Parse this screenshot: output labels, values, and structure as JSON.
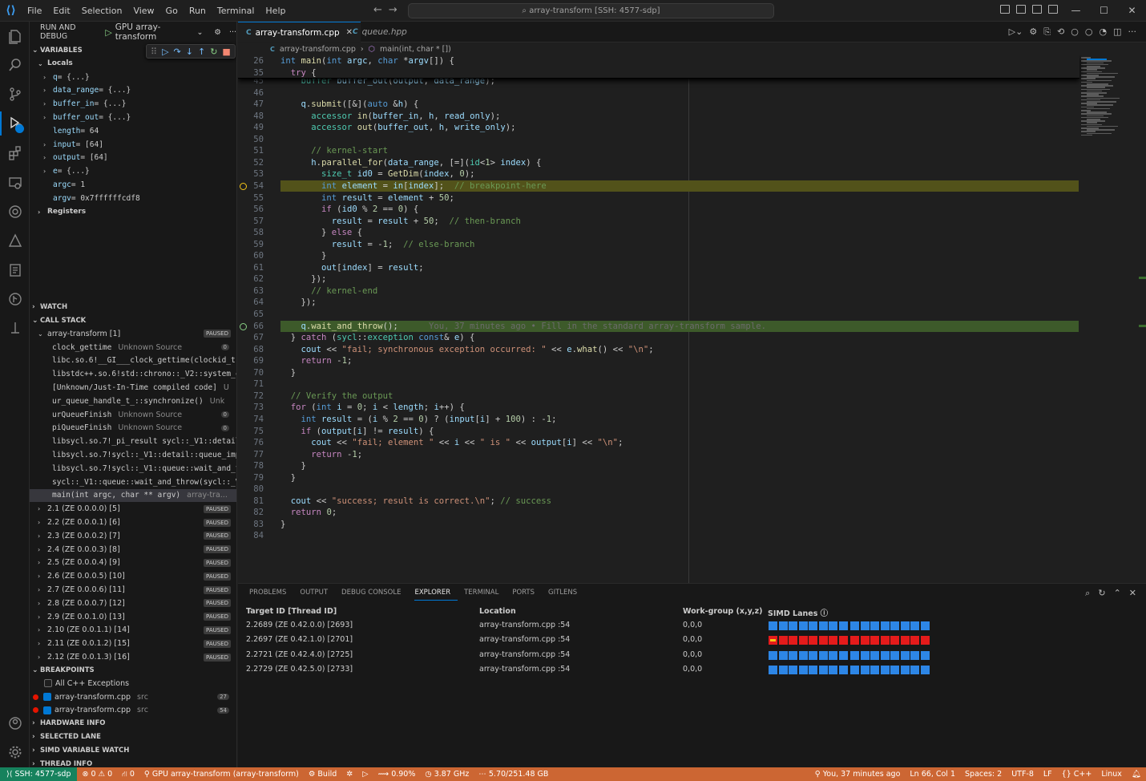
{
  "menu": [
    "File",
    "Edit",
    "Selection",
    "View",
    "Go",
    "Run",
    "Terminal",
    "Help"
  ],
  "search": "array-transform [SSH: 4577-sdp]",
  "sidebar": {
    "header": "RUN AND DEBUG",
    "config": "GPU array-transform",
    "variables_title": "VARIABLES",
    "locals_title": "Locals",
    "variables": [
      {
        "name": "q",
        "value": "= {...}",
        "expandable": true
      },
      {
        "name": "data_range",
        "value": "= {...}",
        "expandable": true
      },
      {
        "name": "buffer_in",
        "value": "= {...}",
        "expandable": true
      },
      {
        "name": "buffer_out",
        "value": "= {...}",
        "expandable": true
      },
      {
        "name": "length",
        "value": "= 64",
        "expandable": false
      },
      {
        "name": "input",
        "value": "= [64]",
        "expandable": true
      },
      {
        "name": "output",
        "value": "= [64]",
        "expandable": true
      },
      {
        "name": "e",
        "value": "= {...}",
        "expandable": true
      },
      {
        "name": "argc",
        "value": "= 1",
        "expandable": false
      },
      {
        "name": "argv",
        "value": "= 0x7ffffffcdf8",
        "expandable": false
      }
    ],
    "registers": "Registers",
    "watch_title": "WATCH",
    "callstack_title": "CALL STACK",
    "thread_main": "array-transform [1]",
    "paused": "PAUSED",
    "frames": [
      {
        "name": "clock_gettime",
        "src": "Unknown Source",
        "num": "0"
      },
      {
        "name": "libc.so.6!__GI___clock_gettime(clockid_t c",
        "src": "",
        "num": ""
      },
      {
        "name": "libstdc++.so.6!std::chrono::_V2::system_cl",
        "src": "",
        "num": ""
      },
      {
        "name": "[Unknown/Just-In-Time compiled code]",
        "src": "U",
        "num": ""
      },
      {
        "name": "ur_queue_handle_t_::synchronize()",
        "src": "Unk",
        "num": ""
      },
      {
        "name": "urQueueFinish",
        "src": "Unknown Source",
        "num": "0"
      },
      {
        "name": "piQueueFinish",
        "src": "Unknown Source",
        "num": "0"
      },
      {
        "name": "libsycl.so.7!_pi_result sycl::_V1::detail:",
        "src": "",
        "num": ""
      },
      {
        "name": "libsycl.so.7!sycl::_V1::detail::queue_impl",
        "src": "",
        "num": ""
      },
      {
        "name": "libsycl.so.7!sycl::_V1::queue::wait_and_thr",
        "src": "",
        "num": ""
      },
      {
        "name": "sycl::_V1::queue::wait_and_throw(sycl::_V1",
        "src": "",
        "num": ""
      },
      {
        "name": "main(int argc, char ** argv)",
        "src": "array-tra...",
        "num": ""
      }
    ],
    "threads": [
      "2.1 (ZE 0.0.0.0) [5]",
      "2.2 (ZE 0.0.0.1) [6]",
      "2.3 (ZE 0.0.0.2) [7]",
      "2.4 (ZE 0.0.0.3) [8]",
      "2.5 (ZE 0.0.0.4) [9]",
      "2.6 (ZE 0.0.0.5) [10]",
      "2.7 (ZE 0.0.0.6) [11]",
      "2.8 (ZE 0.0.0.7) [12]",
      "2.9 (ZE 0.0.1.0) [13]",
      "2.10 (ZE 0.0.1.1) [14]",
      "2.11 (ZE 0.0.1.2) [15]",
      "2.12 (ZE 0.0.1.3) [16]"
    ],
    "breakpoints_title": "BREAKPOINTS",
    "bp_exceptions": "All C++ Exceptions",
    "breakpoints": [
      {
        "file": "array-transform.cpp",
        "dir": "src",
        "line": "27"
      },
      {
        "file": "array-transform.cpp",
        "dir": "src",
        "line": "54"
      }
    ],
    "hardware_info": "HARDWARE INFO",
    "selected_lane": "SELECTED LANE",
    "simd_watch": "SIMD VARIABLE WATCH",
    "thread_info": "THREAD INFO"
  },
  "tabs": [
    {
      "label": "array-transform.cpp",
      "active": true
    },
    {
      "label": "queue.hpp",
      "active": false
    }
  ],
  "breadcrumb": {
    "file": "array-transform.cpp",
    "symbol": "main(int, char * [])"
  },
  "code": {
    "sticky": [
      {
        "ln": "26",
        "html": "<span class='kw'>int</span> <span class='fn'>main</span>(<span class='kw'>int</span> <span class='id'>argc</span>, <span class='kw'>char</span> *<span class='id'>argv</span>[]) {"
      },
      {
        "ln": "35",
        "html": "  <span class='kw2'>try</span> {"
      }
    ],
    "lines": [
      {
        "ln": "45",
        "html": "    <span class='ty'>buffer</span> <span class='id'>buffer_out</span>(<span class='id'>output</span>, <span class='id'>data_range</span>);"
      },
      {
        "ln": "46",
        "html": ""
      },
      {
        "ln": "47",
        "html": "    <span class='id'>q</span>.<span class='fn'>submit</span>([&amp;](<span class='kw'>auto</span> &amp;<span class='id'>h</span>) {"
      },
      {
        "ln": "48",
        "html": "      <span class='ty'>accessor</span> <span class='fn'>in</span>(<span class='id'>buffer_in</span>, <span class='id'>h</span>, <span class='id'>read_only</span>);"
      },
      {
        "ln": "49",
        "html": "      <span class='ty'>accessor</span> <span class='fn'>out</span>(<span class='id'>buffer_out</span>, <span class='id'>h</span>, <span class='id'>write_only</span>);"
      },
      {
        "ln": "50",
        "html": ""
      },
      {
        "ln": "51",
        "html": "      <span class='cm'>// kernel-start</span>"
      },
      {
        "ln": "52",
        "html": "      <span class='id'>h</span>.<span class='fn'>parallel_for</span>(<span class='id'>data_range</span>, [=](<span class='ty'>id</span>&lt;<span class='nm'>1</span>&gt; <span class='id'>index</span>) {"
      },
      {
        "ln": "53",
        "html": "        <span class='ty'>size_t</span> <span class='id'>id0</span> = <span class='fn'>GetDim</span>(<span class='id'>index</span>, <span class='nm'>0</span>);"
      },
      {
        "ln": "54",
        "html": "        <span class='kw'>int</span> <span class='id'>element</span> = <span class='id'>in</span>[<span class='id'>index</span>];  <span class='cm'>// breakpoint-here</span>",
        "hl": "y"
      },
      {
        "ln": "55",
        "html": "        <span class='kw'>int</span> <span class='id'>result</span> = <span class='id'>element</span> + <span class='nm'>50</span>;"
      },
      {
        "ln": "56",
        "html": "        <span class='kw2'>if</span> (<span class='id'>id0</span> % <span class='nm'>2</span> == <span class='nm'>0</span>) {"
      },
      {
        "ln": "57",
        "html": "          <span class='id'>result</span> = <span class='id'>result</span> + <span class='nm'>50</span>;  <span class='cm'>// then-branch</span>"
      },
      {
        "ln": "58",
        "html": "        } <span class='kw2'>else</span> {"
      },
      {
        "ln": "59",
        "html": "          <span class='id'>result</span> = -<span class='nm'>1</span>;  <span class='cm'>// else-branch</span>"
      },
      {
        "ln": "60",
        "html": "        }"
      },
      {
        "ln": "61",
        "html": "        <span class='id'>out</span>[<span class='id'>index</span>] = <span class='id'>result</span>;"
      },
      {
        "ln": "62",
        "html": "      });"
      },
      {
        "ln": "63",
        "html": "      <span class='cm'>// kernel-end</span>"
      },
      {
        "ln": "64",
        "html": "    });"
      },
      {
        "ln": "65",
        "html": ""
      },
      {
        "ln": "66",
        "html": "    <span class='id'>q</span>.<span class='fn'>wait_and_throw</span>();      <span class='lens'>You, 37 minutes ago • Fill in the standard array-transform sample.</span>",
        "hl": "g"
      },
      {
        "ln": "67",
        "html": "  } <span class='kw2'>catch</span> (<span class='ty'>sycl</span>::<span class='ty'>exception</span> <span class='kw'>const</span>&amp; <span class='id'>e</span>) {"
      },
      {
        "ln": "68",
        "html": "    <span class='id'>cout</span> &lt;&lt; <span class='st'>\"fail; synchronous exception occurred: \"</span> &lt;&lt; <span class='id'>e</span>.<span class='fn'>what</span>() &lt;&lt; <span class='st'>\"\\n\"</span>;"
      },
      {
        "ln": "69",
        "html": "    <span class='kw2'>return</span> -<span class='nm'>1</span>;"
      },
      {
        "ln": "70",
        "html": "  }"
      },
      {
        "ln": "71",
        "html": ""
      },
      {
        "ln": "72",
        "html": "  <span class='cm'>// Verify the output</span>"
      },
      {
        "ln": "73",
        "html": "  <span class='kw2'>for</span> (<span class='kw'>int</span> <span class='id'>i</span> = <span class='nm'>0</span>; <span class='id'>i</span> &lt; <span class='id'>length</span>; <span class='id'>i</span>++) {"
      },
      {
        "ln": "74",
        "html": "    <span class='kw'>int</span> <span class='id'>result</span> = (<span class='id'>i</span> % <span class='nm'>2</span> == <span class='nm'>0</span>) ? (<span class='id'>input</span>[<span class='id'>i</span>] + <span class='nm'>100</span>) : -<span class='nm'>1</span>;"
      },
      {
        "ln": "75",
        "html": "    <span class='kw2'>if</span> (<span class='id'>output</span>[<span class='id'>i</span>] != <span class='id'>result</span>) {"
      },
      {
        "ln": "76",
        "html": "      <span class='id'>cout</span> &lt;&lt; <span class='st'>\"fail; element \"</span> &lt;&lt; <span class='id'>i</span> &lt;&lt; <span class='st'>\" is \"</span> &lt;&lt; <span class='id'>output</span>[<span class='id'>i</span>] &lt;&lt; <span class='st'>\"\\n\"</span>;"
      },
      {
        "ln": "77",
        "html": "      <span class='kw2'>return</span> -<span class='nm'>1</span>;"
      },
      {
        "ln": "78",
        "html": "    }"
      },
      {
        "ln": "79",
        "html": "  }"
      },
      {
        "ln": "80",
        "html": ""
      },
      {
        "ln": "81",
        "html": "  <span class='id'>cout</span> &lt;&lt; <span class='st'>\"success; result is correct.\\n\"</span>; <span class='cm'>// success</span>"
      },
      {
        "ln": "82",
        "html": "  <span class='kw2'>return</span> <span class='nm'>0</span>;"
      },
      {
        "ln": "83",
        "html": "}"
      },
      {
        "ln": "84",
        "html": ""
      }
    ]
  },
  "panel": {
    "tabs": [
      "PROBLEMS",
      "OUTPUT",
      "DEBUG CONSOLE",
      "EXPLORER",
      "TERMINAL",
      "PORTS",
      "GITLENS"
    ],
    "active_tab": "EXPLORER",
    "columns": [
      "Target ID [Thread ID]",
      "Location",
      "Work-group (x,y,z)",
      "SIMD Lanes"
    ],
    "rows": [
      {
        "target": "2.2689 (ZE 0.42.0.0) [2693]",
        "location": "array-transform.cpp :54",
        "wg": "0,0,0",
        "color": "blue"
      },
      {
        "target": "2.2697 (ZE 0.42.1.0) [2701]",
        "location": "array-transform.cpp :54",
        "wg": "0,0,0",
        "color": "red"
      },
      {
        "target": "2.2721 (ZE 0.42.4.0) [2725]",
        "location": "array-transform.cpp :54",
        "wg": "0,0,0",
        "color": "blue"
      },
      {
        "target": "2.2729 (ZE 0.42.5.0) [2733]",
        "location": "array-transform.cpp :54",
        "wg": "0,0,0",
        "color": "blue"
      }
    ],
    "lanes_per_row": 16,
    "lane_colors": {
      "blue": "#2d86e6",
      "red": "#e51b1b"
    }
  },
  "status": {
    "remote": "SSH: 4577-sdp",
    "errors": "0",
    "warnings": "0",
    "ports": "0",
    "debug": "GPU array-transform (array-transform)",
    "build": "Build",
    "cpu": "0.90%",
    "freq": "3.87 GHz",
    "mem": "5.70/251.48 GB",
    "blame": "You, 37 minutes ago",
    "position": "Ln 66, Col 1",
    "spaces": "Spaces: 2",
    "encoding": "UTF-8",
    "eol": "LF",
    "lang": "C++",
    "os": "Linux"
  }
}
